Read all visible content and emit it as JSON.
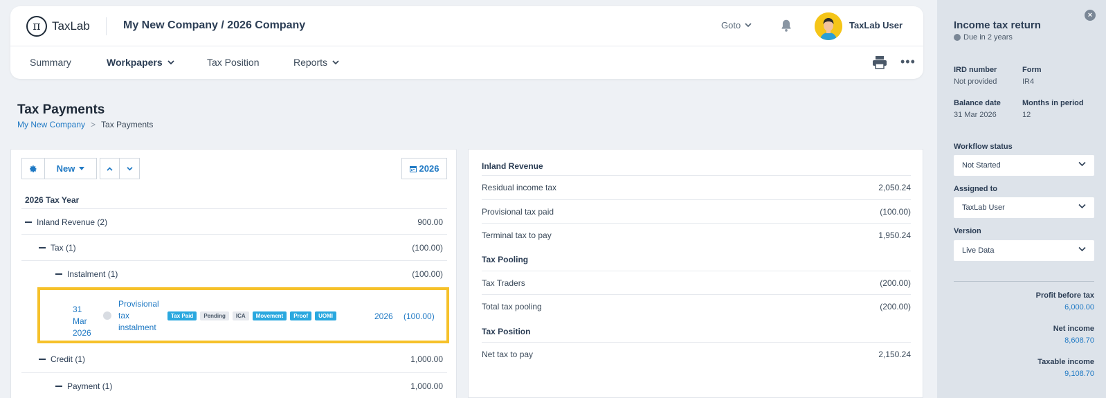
{
  "header": {
    "logo_text": "TaxLab",
    "logo_symbol": "π",
    "company_title": "My New Company / 2026 Company",
    "goto_label": "Goto",
    "username": "TaxLab User"
  },
  "nav": {
    "items": [
      {
        "label": "Summary"
      },
      {
        "label": "Workpapers"
      },
      {
        "label": "Tax Position"
      },
      {
        "label": "Reports"
      }
    ],
    "more_label": "•••"
  },
  "page": {
    "title": "Tax Payments",
    "breadcrumb": {
      "root": "My New Company",
      "separator": ">",
      "current": "Tax Payments"
    }
  },
  "toolbar": {
    "new_label": "New",
    "year_label": "2026"
  },
  "tree": {
    "heading": "2026 Tax Year",
    "rows": [
      {
        "label": "Inland Revenue (2)",
        "amount": "900.00"
      },
      {
        "label": "Tax (1)",
        "amount": "(100.00)"
      },
      {
        "label": "Instalment (1)",
        "amount": "(100.00)"
      },
      {
        "label": "Credit (1)",
        "amount": "1,000.00"
      },
      {
        "label": "Payment (1)",
        "amount": "1,000.00"
      }
    ],
    "selected": {
      "date_day": "31",
      "date_month": "Mar",
      "date_year": "2026",
      "name_line1": "Provisional",
      "name_line2": "tax",
      "name_line3": "instalment",
      "tags": [
        {
          "label": "Tax Paid",
          "style": "blue"
        },
        {
          "label": "Pending",
          "style": "grey"
        },
        {
          "label": "ICA",
          "style": "grey"
        },
        {
          "label": "Movement",
          "style": "blue"
        },
        {
          "label": "Proof",
          "style": "blue"
        },
        {
          "label": "UOMI",
          "style": "blue"
        }
      ],
      "year": "2026",
      "amount": "(100.00)"
    }
  },
  "summary": {
    "inland_heading": "Inland Revenue",
    "inland_rows": [
      {
        "label": "Residual income tax",
        "value": "2,050.24"
      },
      {
        "label": "Provisional tax paid",
        "value": "(100.00)"
      },
      {
        "label": "Terminal tax to pay",
        "value": "1,950.24"
      }
    ],
    "pooling_heading": "Tax Pooling",
    "pooling_rows": [
      {
        "label": "Tax Traders",
        "value": "(200.00)"
      },
      {
        "label": "Total tax pooling",
        "value": "(200.00)"
      }
    ],
    "position_heading": "Tax Position",
    "position_rows": [
      {
        "label": "Net tax to pay",
        "value": "2,150.24"
      }
    ]
  },
  "sidebar": {
    "title": "Income tax return",
    "due": "Due in 2 years",
    "ird_label": "IRD number",
    "ird_value": "Not provided",
    "form_label": "Form",
    "form_value": "IR4",
    "balance_label": "Balance date",
    "balance_value": "31 Mar 2026",
    "months_label": "Months in period",
    "months_value": "12",
    "workflow_label": "Workflow status",
    "workflow_value": "Not Started",
    "assigned_label": "Assigned to",
    "assigned_value": "TaxLab User",
    "version_label": "Version",
    "version_value": "Live Data",
    "profit_label": "Profit before tax",
    "profit_value": "6,000.00",
    "net_label": "Net income",
    "net_value": "8,608.70",
    "taxable_label": "Taxable income",
    "taxable_value": "9,108.70"
  },
  "colors": {
    "accent": "#1f79c4",
    "highlight": "#f6c12a",
    "tag_blue": "#2aa8df",
    "sidebar_bg": "#dde3ea"
  }
}
